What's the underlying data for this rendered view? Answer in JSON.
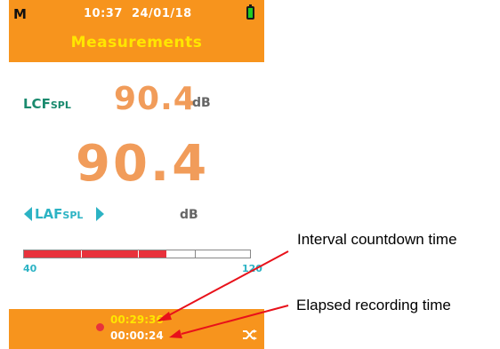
{
  "status_bar": {
    "mode": "M",
    "time": "10:37",
    "date": "24/01/18",
    "battery_color": "#22cc22"
  },
  "screen_title": "Measurements",
  "primary_measure": {
    "label_main": "LCF",
    "label_sub": "SPL",
    "value": "90.4",
    "unit": "dB"
  },
  "secondary_measure": {
    "value": "90.4",
    "label_main": "LAF",
    "label_sub": "SPL",
    "unit": "dB"
  },
  "level_bar": {
    "min_label": "40",
    "max_label": "120",
    "fill_fraction": 0.63,
    "fill_color": "#e8323c"
  },
  "recording": {
    "interval_countdown": "00:29:36",
    "elapsed_time": "00:00:24"
  },
  "callouts": {
    "interval_label": "Interval countdown time",
    "elapsed_label": "Elapsed recording time"
  },
  "colors": {
    "header_orange": "#f7941d",
    "title_yellow": "#ffe600",
    "value_orange": "#f19c5a",
    "accent_teal": "#2cb3c4",
    "label_green": "#1a8a6e"
  }
}
